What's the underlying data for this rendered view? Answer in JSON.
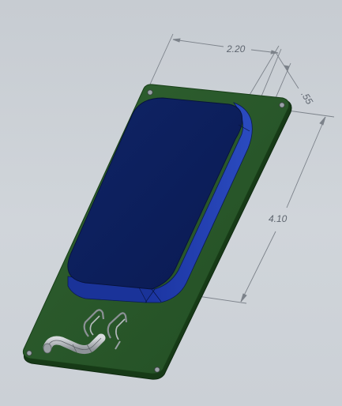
{
  "model_view": {
    "colors": {
      "background": "#c9ced4",
      "board_fill": "#2b5a2b",
      "board_edge": "#173a17",
      "pack_top": "#0d1f5c",
      "pack_side": "#1c36a0",
      "pack_side_light": "#2c4cc0",
      "wire_color": "#a9adb2",
      "dimension_line": "#7c828a",
      "dimension_text": "#5f6670"
    },
    "dimensions": {
      "width_label": "2.20",
      "depth_label": ".55",
      "length_label": "4.10"
    }
  }
}
